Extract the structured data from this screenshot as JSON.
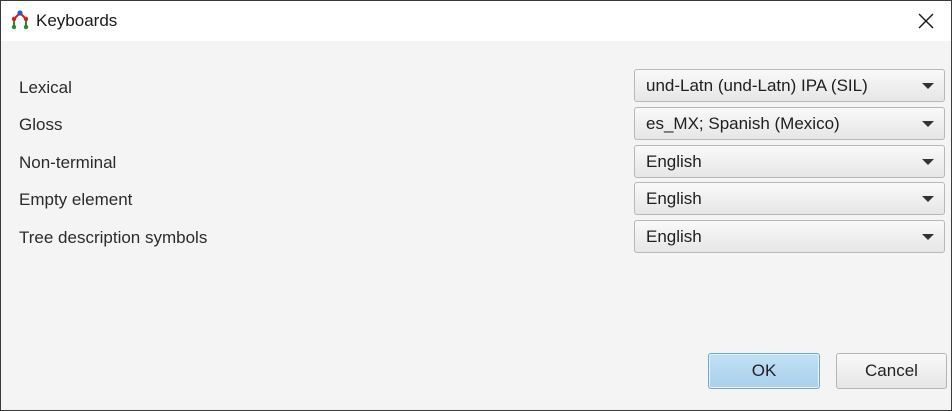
{
  "window": {
    "title": "Keyboards",
    "app_icon": "tree-icon",
    "close_icon": "close-icon"
  },
  "rows": [
    {
      "label": "Lexical",
      "value": "und-Latn (und-Latn) IPA (SIL)"
    },
    {
      "label": "Gloss",
      "value": "es_MX; Spanish (Mexico)"
    },
    {
      "label": "Non-terminal",
      "value": "English"
    },
    {
      "label": "Empty element",
      "value": "English"
    },
    {
      "label": "Tree description symbols",
      "value": "English"
    }
  ],
  "buttons": {
    "ok_label": "OK",
    "cancel_label": "Cancel"
  },
  "colors": {
    "accent_button": "#a9d0ea",
    "dialog_background": "#f4f4f4"
  }
}
